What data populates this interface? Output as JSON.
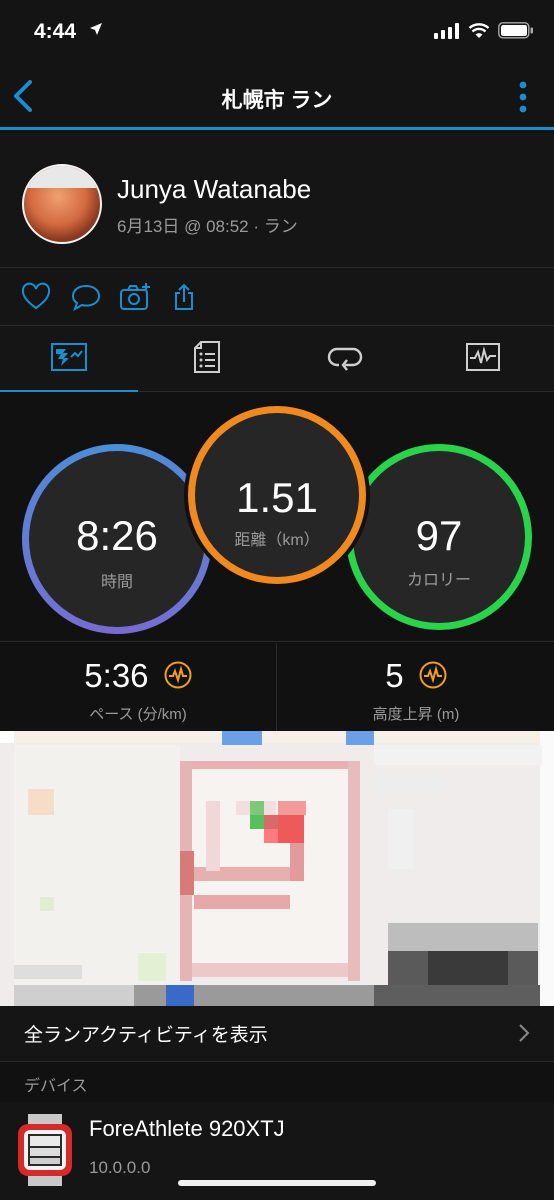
{
  "status": {
    "time": "4:44"
  },
  "nav": {
    "title": "札幌市 ラン"
  },
  "profile": {
    "name": "Junya Watanabe",
    "subtitle": "6月13日 @ 08:52 · ラン"
  },
  "summary": {
    "time": {
      "value": "8:26",
      "label": "時間"
    },
    "distance": {
      "value": "1.51",
      "label": "距離（km）"
    },
    "calories": {
      "value": "97",
      "label": "カロリー"
    }
  },
  "stats": {
    "pace": {
      "value": "5:36",
      "label": "ペース (分/km)"
    },
    "elevation": {
      "value": "5",
      "label": "高度上昇 (m)"
    }
  },
  "links": {
    "all_runs": "全ランアクティビティを表示"
  },
  "devices": {
    "header": "デバイス",
    "items": [
      {
        "name": "ForeAthlete 920XTJ",
        "version": "10.0.0.0"
      }
    ]
  },
  "colors": {
    "accent": "#1a8fd0",
    "time_ring": "#4a8fd8",
    "distance_ring": "#f08a20",
    "calories_ring": "#2ad44a",
    "icon_orange": "#f0a020"
  },
  "icons": [
    "location-arrow-icon",
    "signal-icon",
    "wifi-icon",
    "battery-icon",
    "back-chevron-icon",
    "more-vertical-icon",
    "heart-icon",
    "comment-icon",
    "add-photo-icon",
    "share-icon",
    "overview-tab-icon",
    "details-tab-icon",
    "laps-tab-icon",
    "graphs-tab-icon",
    "pulse-icon",
    "chevron-right-icon"
  ]
}
